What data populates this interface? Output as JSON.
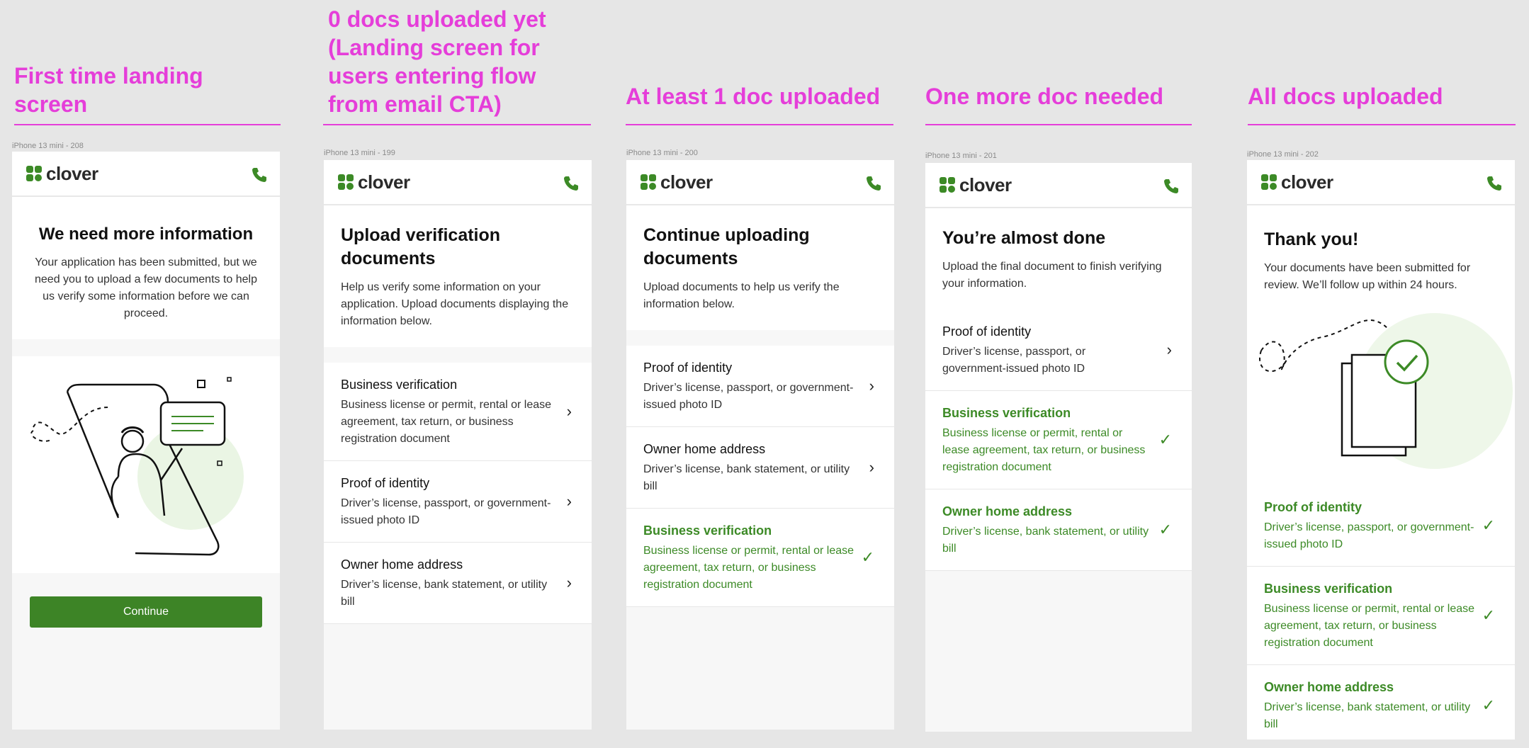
{
  "headings": {
    "s1": [
      "First time landing",
      "screen"
    ],
    "s2": [
      "0 docs uploaded yet",
      "(Landing screen for",
      "users entering flow",
      "from email CTA)"
    ],
    "s3": "At least 1 doc uploaded",
    "s4": "One more doc needed",
    "s5": "All docs uploaded"
  },
  "frame_labels": {
    "s1": "iPhone 13 mini - 208",
    "s2": "iPhone 13 mini - 199",
    "s3": "iPhone 13 mini - 200",
    "s4": "iPhone 13 mini - 201",
    "s5": "iPhone 13 mini - 202"
  },
  "brand": {
    "name": "clover",
    "accent": "#3c8a26",
    "heading_color": "#e53ed9"
  },
  "icons": {
    "logo": "clover-logo-icon",
    "phone": "phone-icon",
    "chevron": "chevron-right-icon",
    "check": "check-icon"
  },
  "chevron_glyph": "›",
  "check_glyph": "✓",
  "screen1": {
    "title": "We need more information",
    "body": "Your application has been submitted, but we need you to upload a few documents to help us verify some information before we can proceed.",
    "button": "Continue"
  },
  "screen2": {
    "title": "Upload verification documents",
    "body": "Help us verify some information on your application. Upload documents displaying the information below.",
    "items": [
      {
        "title": "Business verification",
        "desc": "Business license or permit, rental or lease agreement, tax return, or business registration document"
      },
      {
        "title": "Proof of identity",
        "desc": "Driver’s license, passport, or government-issued photo ID"
      },
      {
        "title": "Owner home address",
        "desc": "Driver’s license, bank statement, or utility bill"
      }
    ]
  },
  "screen3": {
    "title": "Continue uploading documents",
    "body": "Upload documents to help us verify the information below.",
    "items": [
      {
        "title": "Proof of identity",
        "desc": "Driver’s license, passport, or government-issued photo ID"
      },
      {
        "title": "Owner home address",
        "desc": "Driver’s license, bank statement, or utility bill"
      },
      {
        "title": "Business verification",
        "desc": "Business license or permit, rental or lease agreement, tax return, or business registration document"
      }
    ]
  },
  "screen4": {
    "title": "You’re almost done",
    "body": "Upload the final document to finish verifying your information.",
    "items": [
      {
        "title": "Proof of identity",
        "desc": "Driver’s license, passport, or government-issued photo ID"
      },
      {
        "title": "Business verification",
        "desc": "Business license or permit, rental or lease agreement, tax return, or business registration document"
      },
      {
        "title": "Owner home address",
        "desc": "Driver’s license, bank statement, or utility bill"
      }
    ]
  },
  "screen5": {
    "title": "Thank you!",
    "body": "Your documents have been submitted for review. We’ll follow up within 24 hours.",
    "items": [
      {
        "title": "Proof of identity",
        "desc": "Driver’s license, passport, or government-issued photo ID"
      },
      {
        "title": "Business verification",
        "desc": "Business license or permit, rental or lease agreement, tax return, or business registration document"
      },
      {
        "title": "Owner home address",
        "desc": "Driver’s license, bank statement, or utility bill"
      }
    ]
  }
}
